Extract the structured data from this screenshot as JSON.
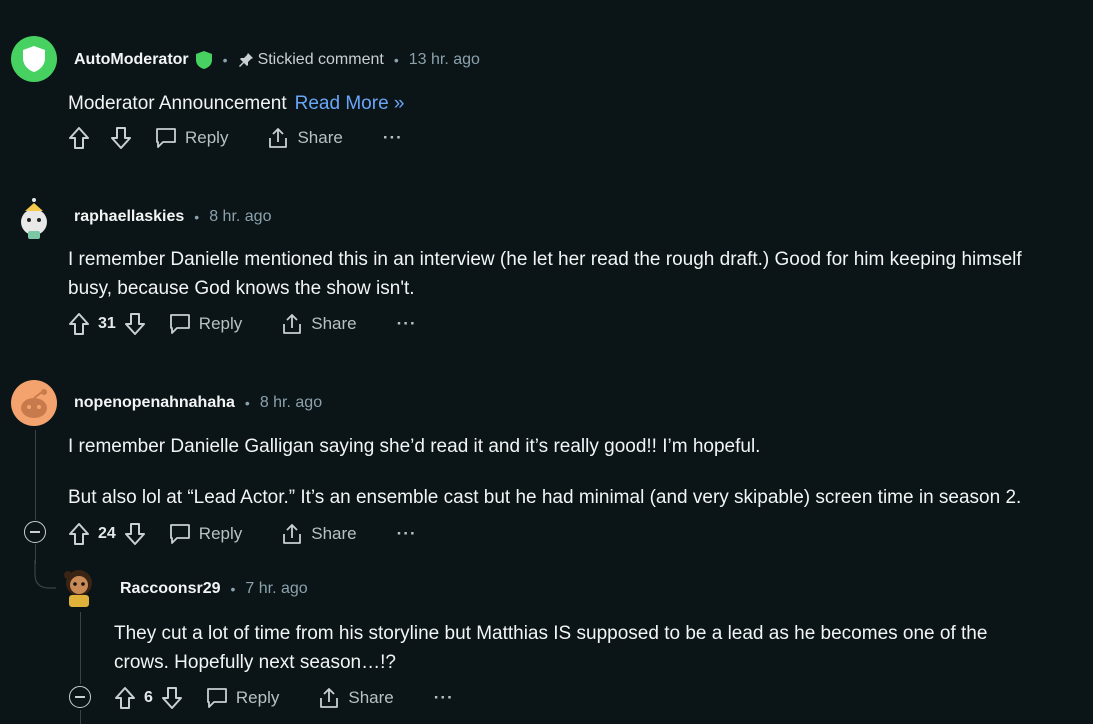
{
  "comments": [
    {
      "author": "AutoModerator",
      "sticky_label": "Stickied comment",
      "time": "13 hr. ago",
      "text": "Moderator Announcement",
      "link": "Read More »",
      "reply": "Reply",
      "share": "Share",
      "more": "···"
    },
    {
      "author": "raphaellaskies",
      "time": "8 hr. ago",
      "text_line1": "I remember Danielle mentioned this in an interview (he let her read the rough draft.) Good for him keeping himself",
      "text_line2": "busy, because God knows the show isn't.",
      "votes": "31",
      "reply": "Reply",
      "share": "Share",
      "more": "···"
    },
    {
      "author": "nopenopenahnahaha",
      "time": "8 hr. ago",
      "text_p1": "I remember Danielle Galligan saying she’d read it and it’s really good!! I’m hopeful.",
      "text_p2": "But also lol at “Lead Actor.” It’s an ensemble cast but he had minimal (and very skipable) screen time in season 2.",
      "votes": "24",
      "reply": "Reply",
      "share": "Share",
      "more": "···"
    },
    {
      "author": "Raccoonsr29",
      "time": "7 hr. ago",
      "text_line1": "They cut a lot of time from his storyline but Matthias IS supposed to be a lead as he becomes one of the",
      "text_line2": "crows. Hopefully next season…!?",
      "votes": "6",
      "reply": "Reply",
      "share": "Share",
      "more": "···"
    }
  ],
  "colors": {
    "background": "#0b1416",
    "link": "#6aa6f8",
    "mod_green": "#46d160",
    "muted": "#8ba2ad"
  }
}
